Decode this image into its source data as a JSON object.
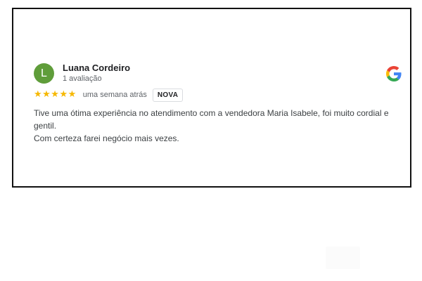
{
  "review": {
    "avatar_letter": "L",
    "avatar_color": "#5f9d3a",
    "reviewer_name": "Luana Cordeiro",
    "review_count": "1 avaliação",
    "rating": 5,
    "rating_max": 5,
    "stars_display": "★★★★★",
    "star_color": "#f6b800",
    "date": "uma semana atrás",
    "badge": "NOVA",
    "text_line_1": "Tive uma ótima experiência no atendimento com a vendedora Maria Isabele, foi muito cordial e gentil.",
    "text_line_2": "Com certeza farei negócio mais vezes.",
    "source_icon": "google-g-icon"
  }
}
